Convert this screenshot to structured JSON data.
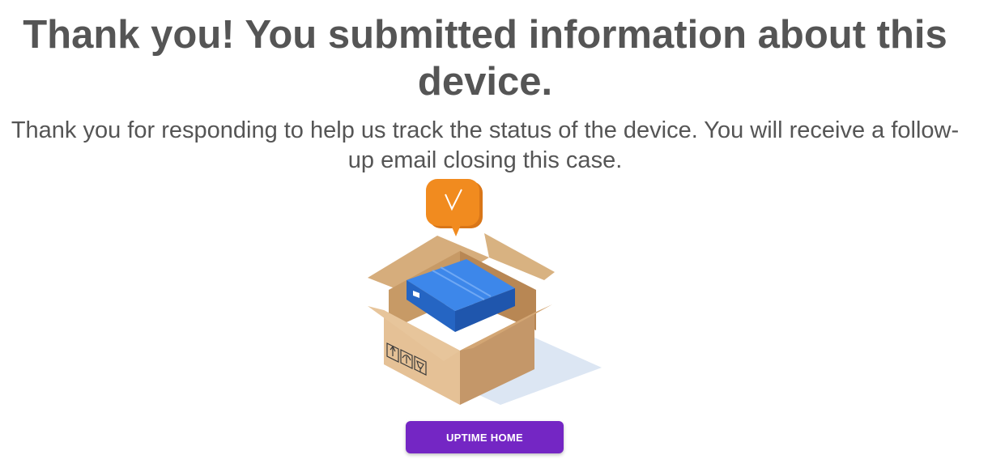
{
  "confirmation": {
    "title": "Thank you! You submitted information about this device.",
    "message": "Thank you for responding to help us track the status of the device. You will receive a follow-up email closing this case."
  },
  "illustration": {
    "icons": [
      "checkmark-bubble-icon",
      "cardboard-box-icon",
      "blue-device-icon",
      "this-way-up-icon",
      "umbrella-icon",
      "fragile-glass-icon"
    ],
    "colors": {
      "bubble": "#f0891f",
      "box": "#d9b07f",
      "device": "#2f78dd",
      "shadow": "#dce6f3"
    }
  },
  "actions": {
    "home_label": "UPTIME HOME"
  },
  "colors": {
    "text": "#555555",
    "button": "#7426c4",
    "button_text": "#ffffff"
  }
}
